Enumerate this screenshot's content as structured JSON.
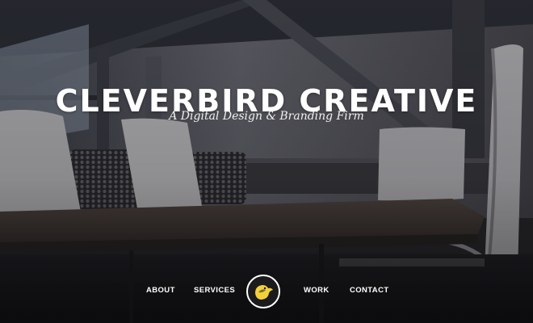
{
  "hero": {
    "title": "CLEVERBIRD CREATIVE",
    "tagline": "A Digital Design & Branding Firm"
  },
  "nav": {
    "items": [
      {
        "label": "ABOUT"
      },
      {
        "label": "SERVICES"
      },
      {
        "label": "WORK"
      },
      {
        "label": "CONTACT"
      }
    ],
    "logo_icon": "cleverbird-logo-icon"
  },
  "colors": {
    "text": "#ffffff",
    "logo_accent": "#f2d03b",
    "background": "#2b2b2e"
  }
}
